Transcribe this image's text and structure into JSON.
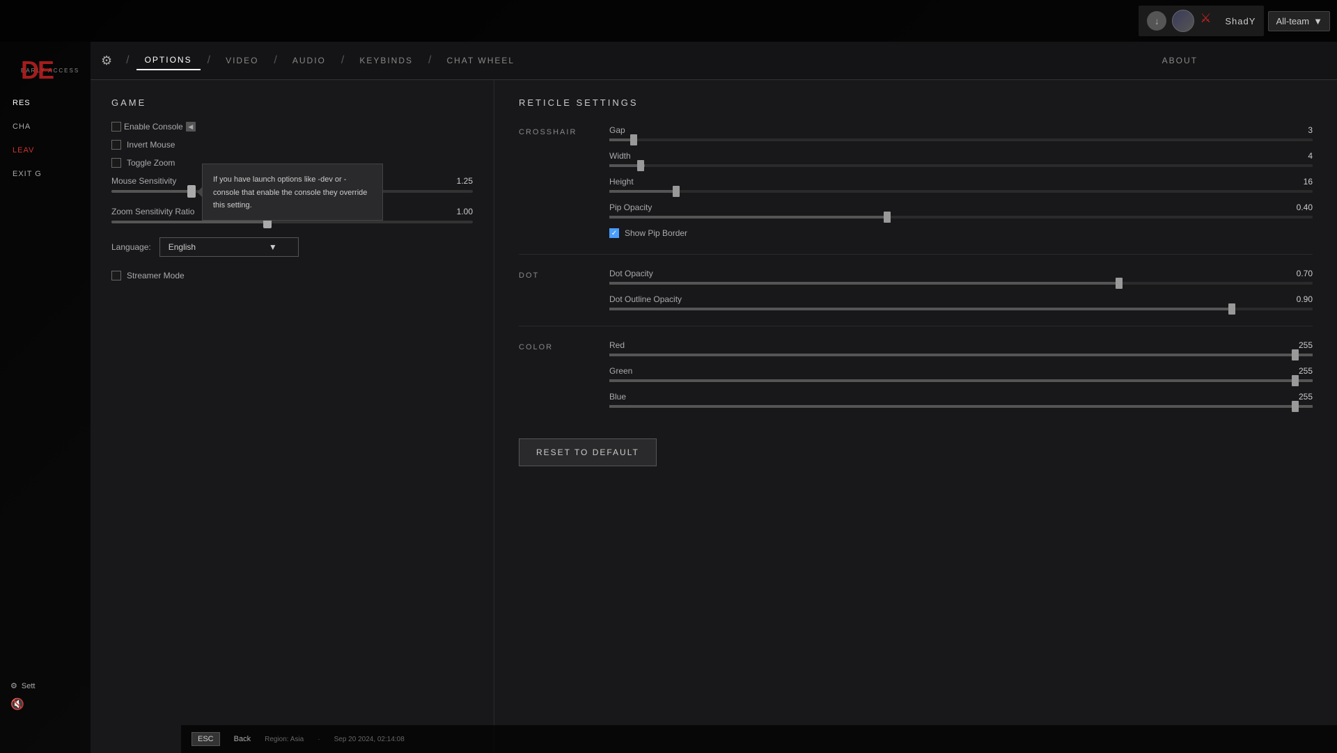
{
  "topbar": {
    "download_icon": "↓",
    "username": "ShadY",
    "all_team_label": "All-team",
    "chevron": "▼"
  },
  "sidebar": {
    "logo": "DE",
    "subtitle": "EARLY ACCESS",
    "items": [
      {
        "id": "res",
        "label": "Res"
      },
      {
        "id": "cha",
        "label": "Cha"
      },
      {
        "id": "leave",
        "label": "Leav",
        "style": "red"
      }
    ],
    "exit_label": "Exit G",
    "settings_label": "Sett",
    "settings_icon": "⚙",
    "sound_icon": "🔇"
  },
  "nav": {
    "gear_icon": "⚙",
    "tabs": [
      {
        "id": "options",
        "label": "OPTIONS",
        "active": true
      },
      {
        "id": "video",
        "label": "VIDEO",
        "active": false
      },
      {
        "id": "audio",
        "label": "AUDIO",
        "active": false
      },
      {
        "id": "keybinds",
        "label": "KEYBINDS",
        "active": false
      },
      {
        "id": "chat_wheel",
        "label": "CHAT WHEEL",
        "active": false
      }
    ],
    "about_label": "ABOUT"
  },
  "game": {
    "section_title": "GAME",
    "enable_console": {
      "label": "Enable Console",
      "checked": false
    },
    "invert_mouse": {
      "label": "Invert Mouse",
      "checked": false
    },
    "toggle_zoom": {
      "label": "Toggle Zoom",
      "checked": false
    },
    "mouse_sensitivity": {
      "label": "Mouse Sensitivity",
      "value": "1.25",
      "fill_pct": 22
    },
    "zoom_sensitivity": {
      "label": "Zoom Sensitivity Ratio",
      "value": "1.00",
      "fill_pct": 43
    },
    "language_label": "Language:",
    "language_value": "English",
    "streamer_mode": {
      "label": "Streamer Mode",
      "checked": false
    }
  },
  "tooltip": {
    "text": "If you have launch options like -dev or -console that enable the console they override this setting."
  },
  "reticle": {
    "section_title": "RETICLE SETTINGS",
    "crosshair_label": "CROSSHAIR",
    "dot_label": "DOT",
    "color_label": "COLOR",
    "sliders": {
      "gap": {
        "label": "Gap",
        "value": "3",
        "fill_pct": 4
      },
      "width": {
        "label": "Width",
        "value": "4",
        "fill_pct": 5
      },
      "height": {
        "label": "Height",
        "value": "16",
        "fill_pct": 10
      },
      "pip_opacity": {
        "label": "Pip Opacity",
        "value": "0.40",
        "fill_pct": 40
      },
      "dot_opacity": {
        "label": "Dot Opacity",
        "value": "0.70",
        "fill_pct": 73
      },
      "dot_outline_opacity": {
        "label": "Dot Outline Opacity",
        "value": "0.90",
        "fill_pct": 89
      },
      "red": {
        "label": "Red",
        "value": "255",
        "fill_pct": 100
      },
      "green": {
        "label": "Green",
        "value": "255",
        "fill_pct": 100
      },
      "blue": {
        "label": "Blue",
        "value": "255",
        "fill_pct": 100
      }
    },
    "show_pip_border": {
      "label": "Show Pip Border",
      "checked": true
    },
    "reset_button": "RESET TO DEFAULT"
  },
  "bottom": {
    "esc_label": "ESC",
    "back_label": "Back",
    "region": "Region: Asia",
    "datetime": "Sep 20 2024, 02:14:08"
  }
}
